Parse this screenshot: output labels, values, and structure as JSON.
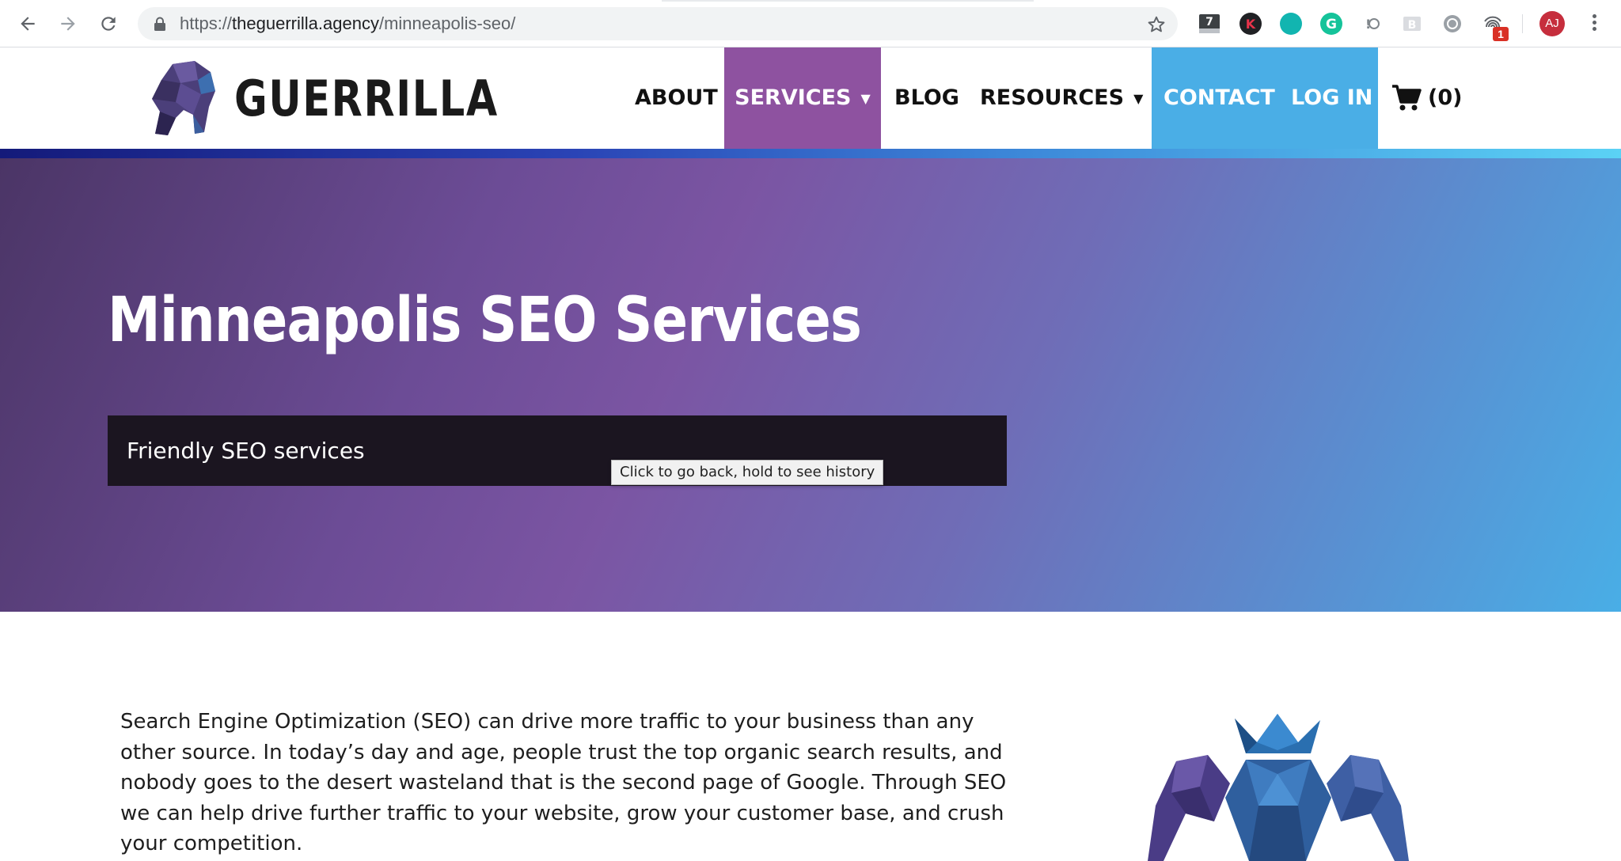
{
  "browser": {
    "url_scheme": "https://",
    "url_host": "theguerrilla.agency",
    "url_path": "/minneapolis-seo/",
    "extension_badge": "1",
    "avatar_initials": "AJ",
    "ext_number_label": "7",
    "ext_k_label": "K",
    "ext_g_label": "G",
    "ext_b_label": "B"
  },
  "site": {
    "logo_text": "GUERRILLA",
    "nav": {
      "about": "ABOUT",
      "services": "SERVICES",
      "blog": "BLOG",
      "resources": "RESOURCES",
      "contact": "CONTACT",
      "login": "LOG IN",
      "cart_count": "(0)"
    }
  },
  "hero": {
    "title": "Minneapolis SEO Services",
    "tagline": "Friendly SEO services"
  },
  "tooltip": "Click to go back, hold to see history",
  "content": {
    "intro": "Search Engine Optimization (SEO) can drive more traffic to your business than any other source. In today’s day and age, people trust the top organic search results, and nobody goes to the desert wasteland that is the second page of Google. Through SEO we can help drive further traffic to your website, grow your customer base, and crush your competition."
  },
  "colors": {
    "services_bg": "#8e52a0",
    "cta_bg": "#4aaee6",
    "tagline_bg": "#1b1520",
    "avatar_bg": "#c62e3d"
  },
  "icons": [
    "back-arrow-icon",
    "forward-arrow-icon",
    "reload-icon",
    "lock-icon",
    "star-icon",
    "cart-icon",
    "gorilla-logo-icon",
    "gorilla-king-mascot-icon"
  ]
}
